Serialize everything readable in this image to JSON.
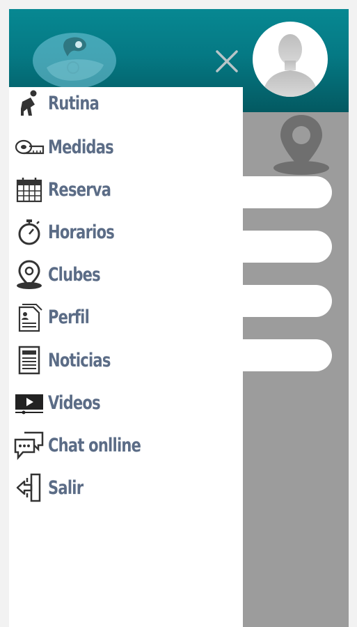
{
  "menu": {
    "items": [
      {
        "label": "Rutina",
        "icon": "exercise-icon"
      },
      {
        "label": "Medidas",
        "icon": "measuring-tape-icon"
      },
      {
        "label": "Reserva",
        "icon": "calendar-icon"
      },
      {
        "label": "Horarios",
        "icon": "stopwatch-icon"
      },
      {
        "label": "Clubes",
        "icon": "map-pin-icon"
      },
      {
        "label": "Perfil",
        "icon": "profile-document-icon"
      },
      {
        "label": "Noticias",
        "icon": "newspaper-icon"
      },
      {
        "label": "Videos",
        "icon": "video-player-icon"
      },
      {
        "label": "Chat onlline",
        "icon": "chat-bubbles-icon"
      },
      {
        "label": "Salir",
        "icon": "exit-door-icon"
      }
    ]
  },
  "colors": {
    "header_teal": "#057984",
    "menu_text": "#5b6c86",
    "background_grey": "#9c9c9c",
    "drawer": "#ffffff"
  }
}
